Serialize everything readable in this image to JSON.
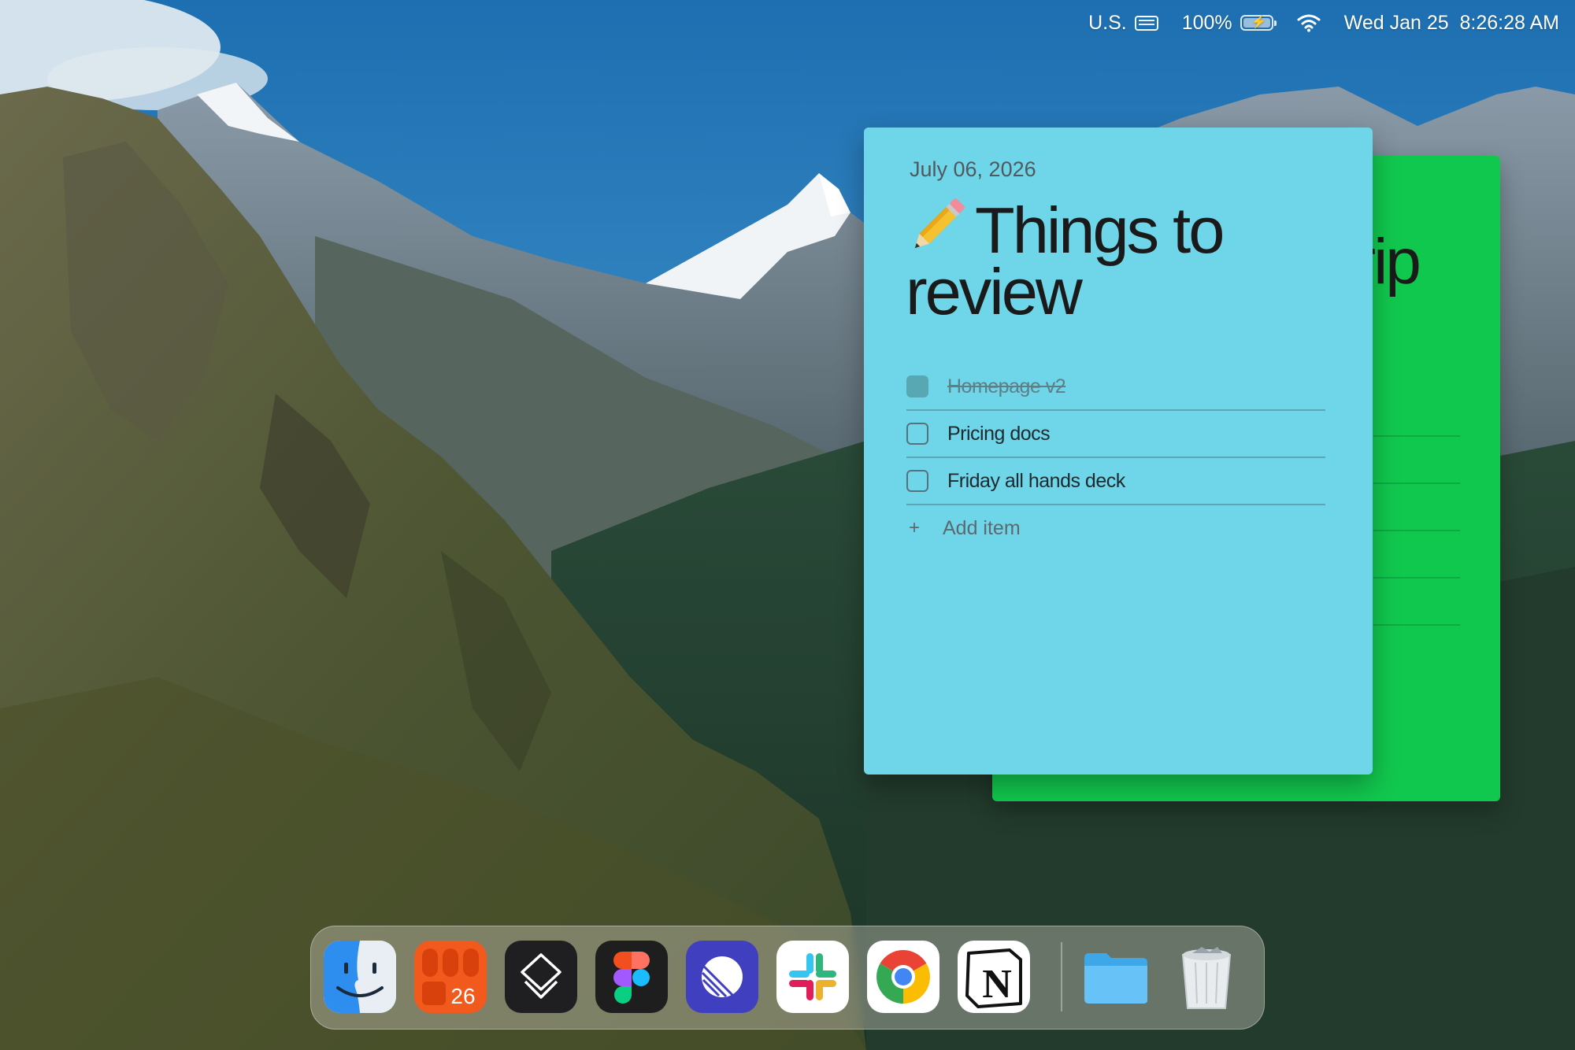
{
  "menubar": {
    "input_source": "U.S.",
    "battery_percent": "100%",
    "battery_level": 1.0,
    "battery_charging": true,
    "datetime": "Wed Jan 25  8:26:28 AM"
  },
  "notes": {
    "front": {
      "date": "July 06, 2026",
      "emoji": "pencil",
      "title": "Things to review",
      "color": "#6fd5e8",
      "items": [
        {
          "label": "Homepage v2",
          "checked": true
        },
        {
          "label": "Pricing docs",
          "checked": false
        },
        {
          "label": "Friday all hands deck",
          "checked": false
        }
      ],
      "add_item_label": "Add item"
    },
    "back": {
      "visible_title_fragment": "trip",
      "color": "#11c84e"
    }
  },
  "dock": {
    "apps": [
      {
        "icon": "finder-icon"
      },
      {
        "icon": "fantastical-icon",
        "badge_text": "26"
      },
      {
        "icon": "craft-icon"
      },
      {
        "icon": "figma-icon"
      },
      {
        "icon": "linear-icon"
      },
      {
        "icon": "slack-icon"
      },
      {
        "icon": "chrome-icon"
      },
      {
        "icon": "notion-icon",
        "text": "N"
      },
      {
        "icon": "folder-icon"
      },
      {
        "icon": "trash-icon"
      }
    ]
  }
}
